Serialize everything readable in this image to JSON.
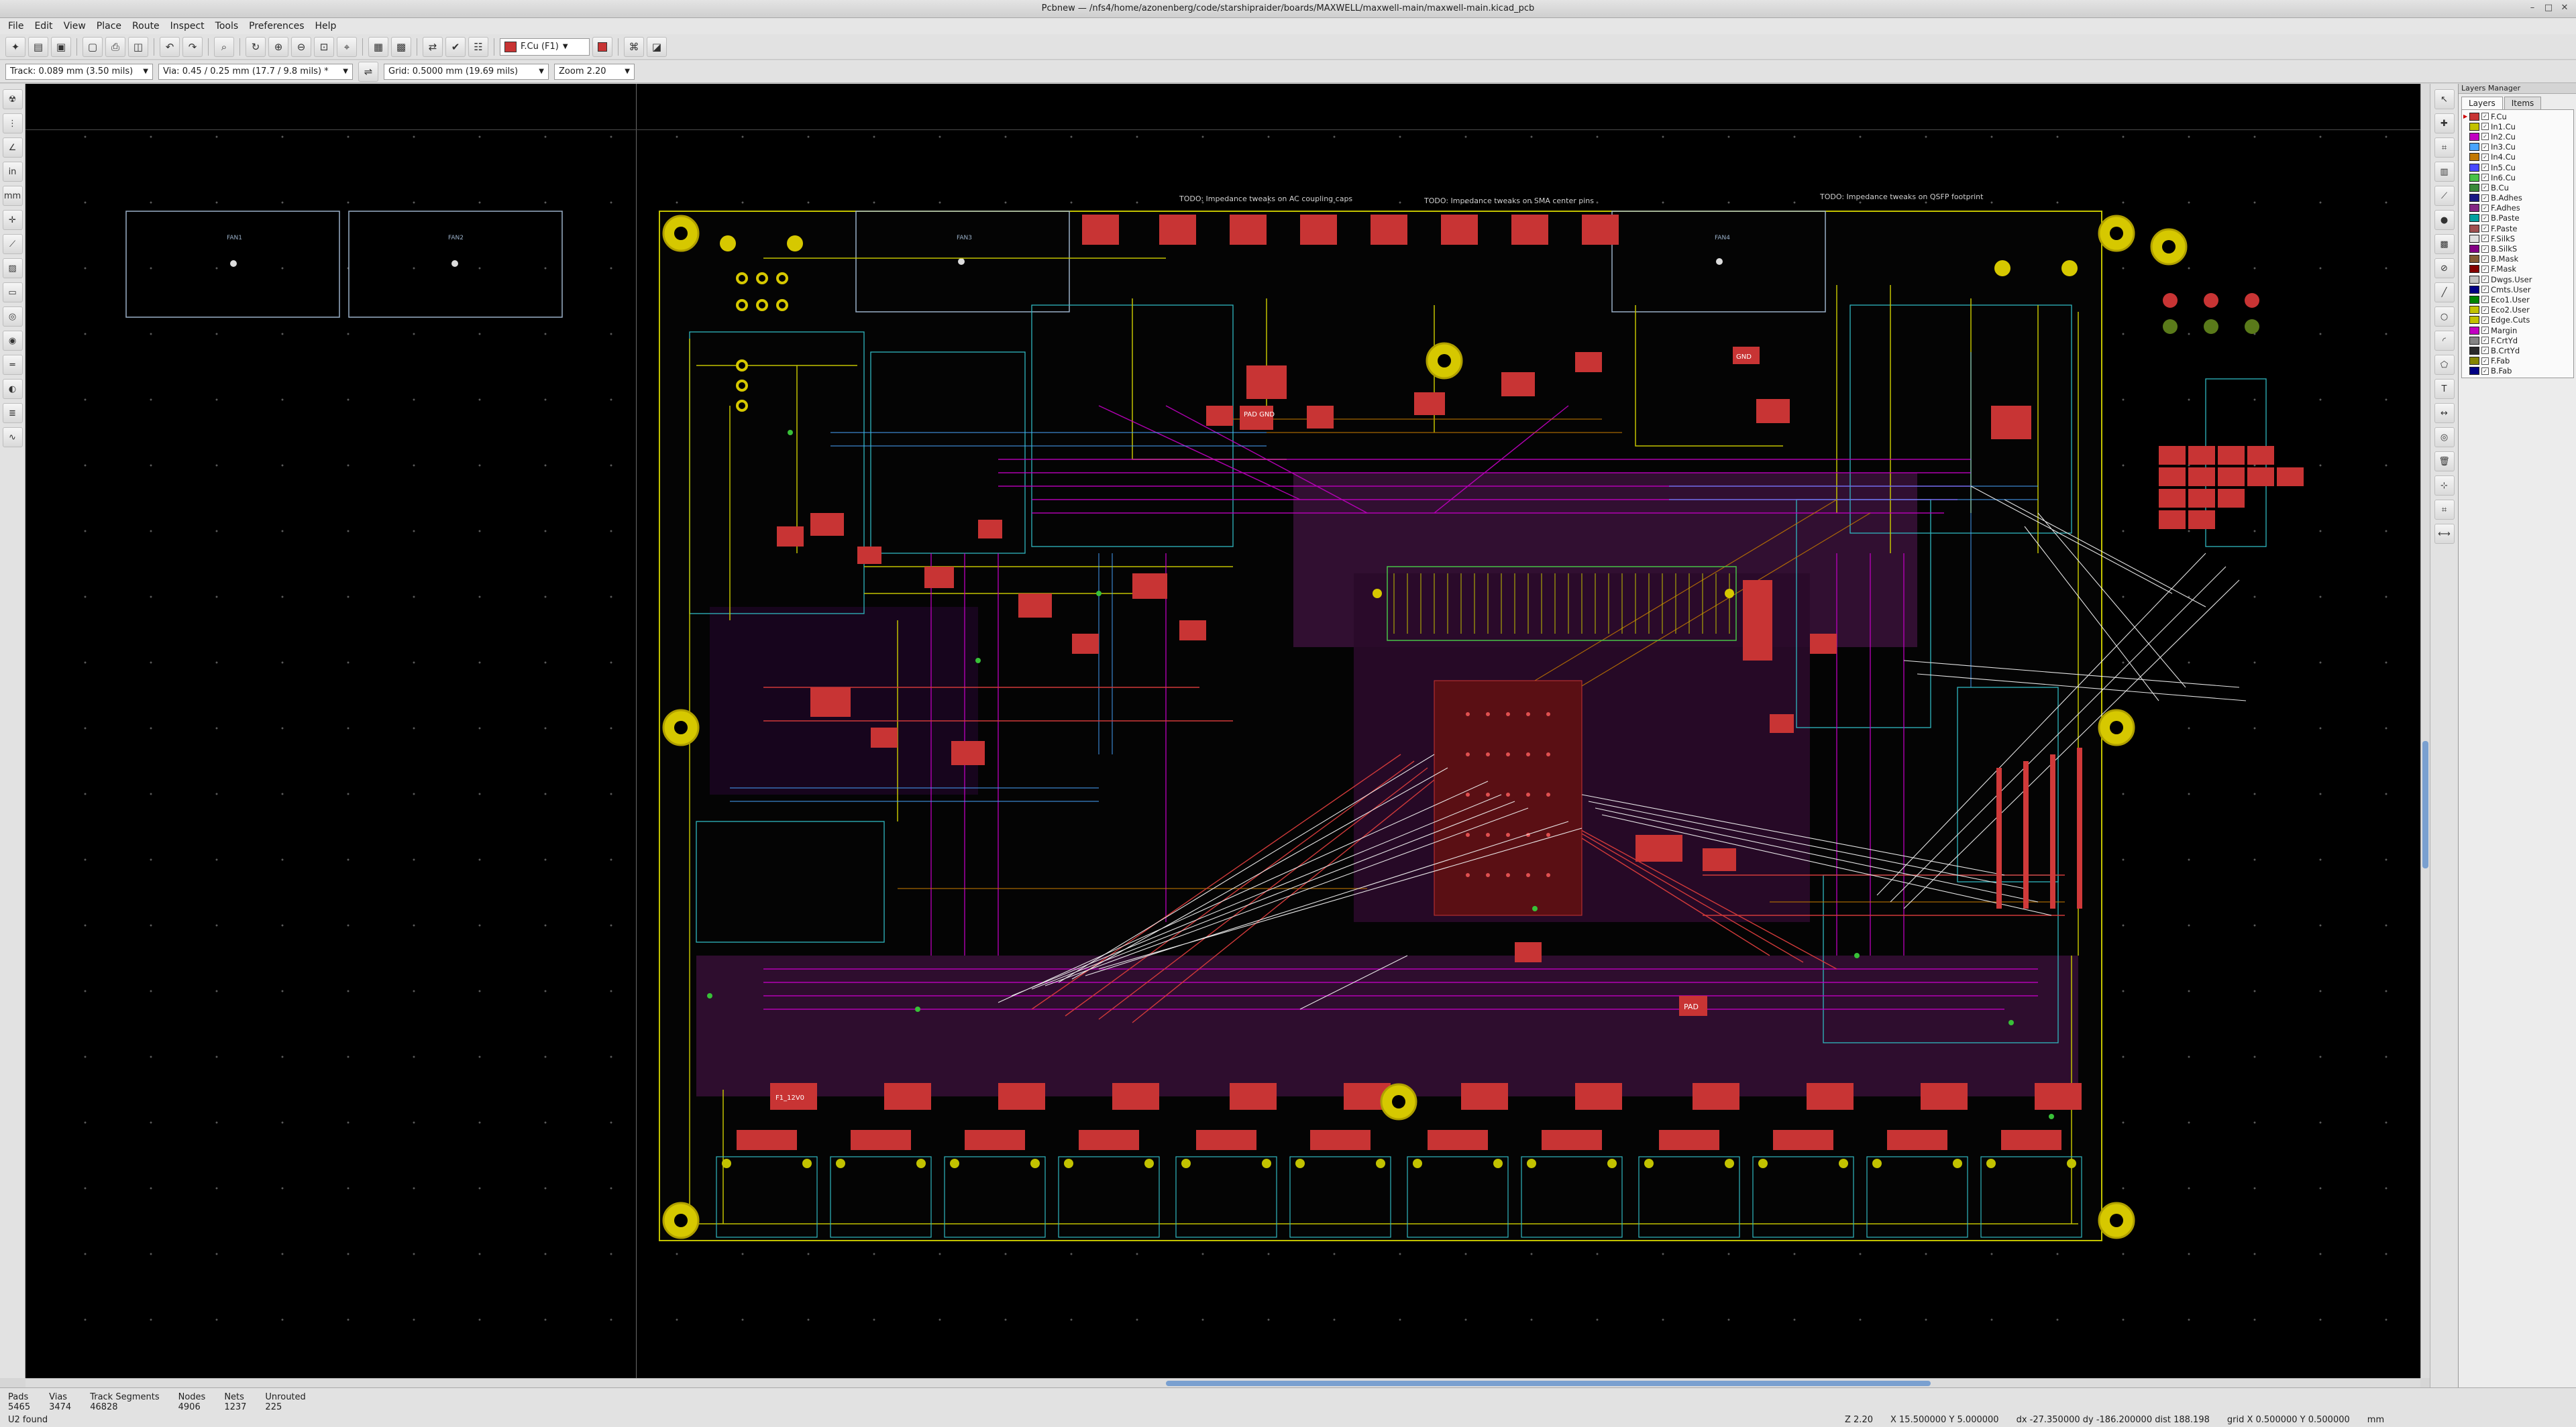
{
  "window": {
    "title": "Pcbnew — /nfs4/home/azonenberg/code/starshipraider/boards/MAXWELL/maxwell-main/maxwell-main.kicad_pcb"
  },
  "menu": [
    "File",
    "Edit",
    "View",
    "Place",
    "Route",
    "Inspect",
    "Tools",
    "Preferences",
    "Help"
  ],
  "toolbar": {
    "active_layer": "F.Cu (F1)",
    "track": "Track: 0.089 mm (3.50 mils)",
    "via": "Via: 0.45 / 0.25 mm (17.7 / 9.8 mils) *",
    "grid": "Grid: 0.5000 mm (19.69 mils)",
    "zoom": "Zoom 2.20"
  },
  "board_annotations": [
    "TODO: Impedance tweaks on AC coupling caps",
    "TODO: Impedance tweaks on SMA center pins",
    "TODO: Impedance tweaks on QSFP footprint"
  ],
  "board_labels": {
    "fan1": "FAN1",
    "fan2": "FAN2",
    "fan3": "FAN3",
    "fan4": "FAN4",
    "pad_gnd": "PAD GND",
    "pad": "PAD",
    "gnd": "GND",
    "fuse": "F1_12V0"
  },
  "layers_manager": {
    "title": "Layers Manager",
    "tabs": [
      "Layers",
      "Items"
    ],
    "layers": [
      {
        "name": "F.Cu",
        "color": "#c83434",
        "checked": true
      },
      {
        "name": "In1.Cu",
        "color": "#c2c200",
        "checked": true
      },
      {
        "name": "In2.Cu",
        "color": "#c200c2",
        "checked": true
      },
      {
        "name": "In3.Cu",
        "color": "#48a4ff",
        "checked": true
      },
      {
        "name": "In4.Cu",
        "color": "#c27800",
        "checked": true
      },
      {
        "name": "In5.Cu",
        "color": "#4848ff",
        "checked": true
      },
      {
        "name": "In6.Cu",
        "color": "#48c248",
        "checked": true
      },
      {
        "name": "B.Cu",
        "color": "#3a8a3a",
        "checked": true
      },
      {
        "name": "B.Adhes",
        "color": "#1a1a84",
        "checked": true
      },
      {
        "name": "F.Adhes",
        "color": "#842684",
        "checked": true
      },
      {
        "name": "B.Paste",
        "color": "#00a0a0",
        "checked": true
      },
      {
        "name": "F.Paste",
        "color": "#a05050",
        "checked": true
      },
      {
        "name": "F.SilkS",
        "color": "#e0e0e0",
        "checked": true
      },
      {
        "name": "B.SilkS",
        "color": "#840084",
        "checked": true
      },
      {
        "name": "B.Mask",
        "color": "#845a34",
        "checked": true
      },
      {
        "name": "F.Mask",
        "color": "#840000",
        "checked": true
      },
      {
        "name": "Dwgs.User",
        "color": "#c2c2c2",
        "checked": true
      },
      {
        "name": "Cmts.User",
        "color": "#000084",
        "checked": true
      },
      {
        "name": "Eco1.User",
        "color": "#008400",
        "checked": true
      },
      {
        "name": "Eco2.User",
        "color": "#c2c200",
        "checked": true
      },
      {
        "name": "Edge.Cuts",
        "color": "#c2c200",
        "checked": true
      },
      {
        "name": "Margin",
        "color": "#c200c2",
        "checked": true
      },
      {
        "name": "F.CrtYd",
        "color": "#848484",
        "checked": true
      },
      {
        "name": "B.CrtYd",
        "color": "#2a2a2a",
        "checked": true
      },
      {
        "name": "F.Fab",
        "color": "#848400",
        "checked": true
      },
      {
        "name": "B.Fab",
        "color": "#000084",
        "checked": true
      }
    ]
  },
  "status": {
    "pads_label": "Pads",
    "pads": "5465",
    "vias_label": "Vias",
    "vias": "3474",
    "tracks_label": "Track Segments",
    "tracks": "46828",
    "nodes_label": "Nodes",
    "nodes": "4906",
    "nets_label": "Nets",
    "nets": "1237",
    "unrouted_label": "Unrouted",
    "unrouted": "225",
    "message": "U2 found",
    "zoom": "Z 2.20",
    "xy": "X 15.500000  Y 5.000000",
    "delta": "dx -27.350000  dy -186.200000  dist 188.198",
    "grid": "grid X 0.500000  Y 0.500000",
    "units": "mm"
  }
}
